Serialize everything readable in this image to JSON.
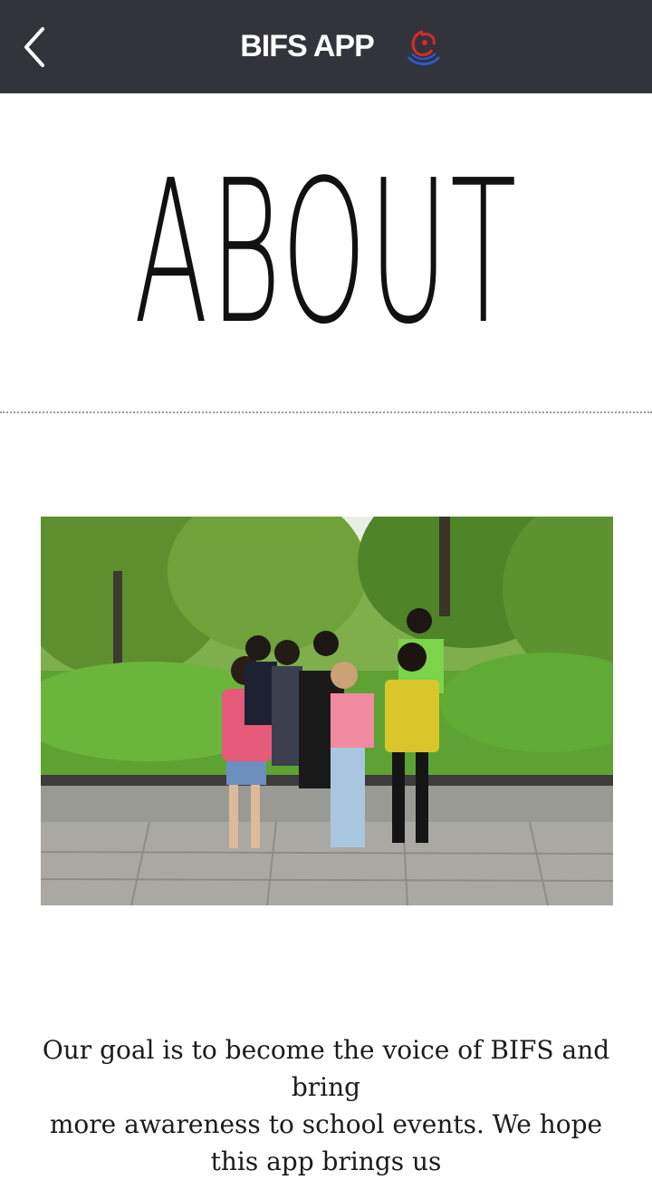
{
  "header": {
    "title": "BIFS APP",
    "back_icon": "chevron-left-icon",
    "logo_icon": "bifs-logo-icon",
    "background_color": "#33333b"
  },
  "page": {
    "heading": "About",
    "photo_description": "group-photo",
    "body_text": "Our goal is to become the voice of BIFS and bring\nmore awareness to school events. We hope\nthis app brings us"
  }
}
